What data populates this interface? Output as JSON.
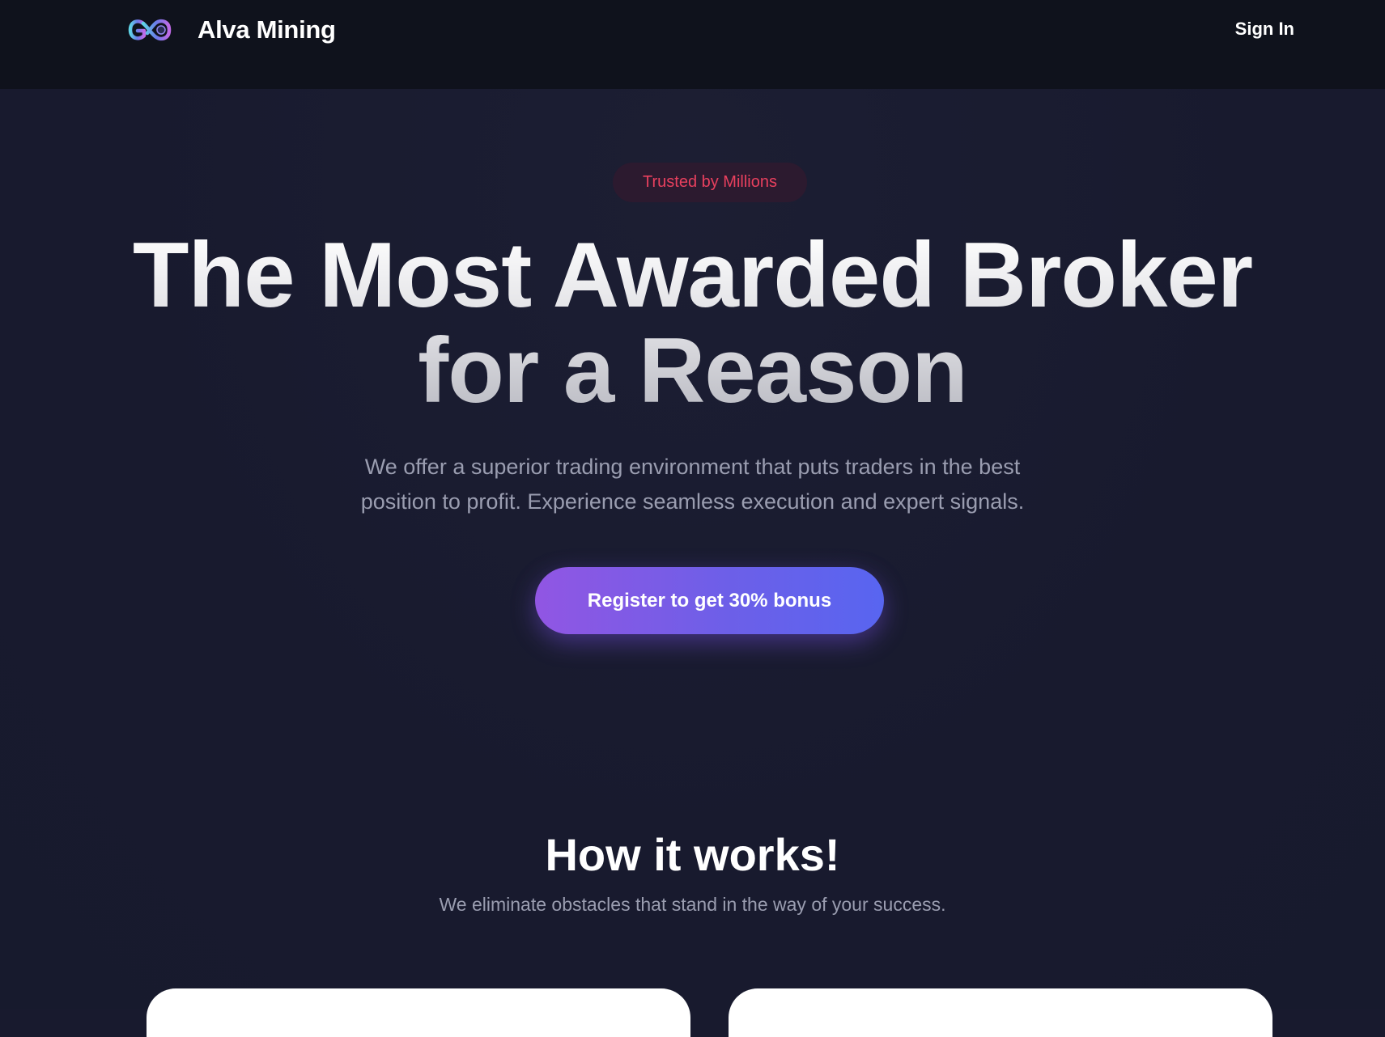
{
  "header": {
    "brand_name": "Alva Mining",
    "logo_icon": "infinity-logo-icon",
    "signin_label": "Sign In"
  },
  "hero": {
    "badge": "Trusted by Millions",
    "headline_line1": "The Most Awarded Broker",
    "headline_line2": "for a Reason",
    "subtext_line1": "We offer a superior trading environment that puts traders in the best",
    "subtext_line2": "position to profit. Experience seamless execution and expert signals.",
    "cta_label": "Register to get 30% bonus"
  },
  "how_it_works": {
    "title": "How it works!",
    "subtitle": "We eliminate obstacles that stand in the way of your success."
  },
  "colors": {
    "background": "#181a2e",
    "navbar": "#0f121c",
    "badge_text": "#e8405e",
    "badge_bg": "#2c1a2f",
    "cta_gradient_start": "#9156e3",
    "cta_gradient_end": "#5865f0",
    "muted_text": "#9a9db0"
  }
}
